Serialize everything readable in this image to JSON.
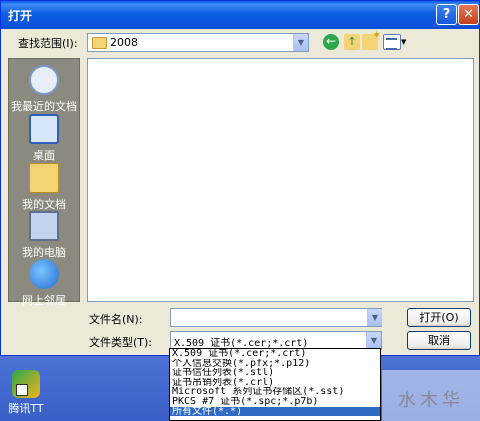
{
  "window": {
    "title": "打开",
    "help_label": "?",
    "close_label": "✕"
  },
  "toolbar": {
    "lookin_label": "查找范围(I):",
    "lookin_value": "2008",
    "back_icon": "back-arrow-icon",
    "up_icon": "up-folder-icon",
    "new_folder_icon": "new-folder-icon",
    "view_menu_icon": "view-menu-icon"
  },
  "places": [
    {
      "label": "我最近的文档",
      "icon": "recent-documents-icon"
    },
    {
      "label": "桌面",
      "icon": "desktop-icon"
    },
    {
      "label": "我的文档",
      "icon": "my-documents-icon"
    },
    {
      "label": "我的电脑",
      "icon": "my-computer-icon"
    },
    {
      "label": "网上邻居",
      "icon": "network-places-icon"
    }
  ],
  "form": {
    "filename_label": "文件名(N):",
    "filename_value": "",
    "filetype_label": "文件类型(T):",
    "filetype_value": "X.509 证书(*.cer;*.crt)",
    "open_button": "打开(O)",
    "cancel_button": "取消"
  },
  "filetype_options": [
    "X.509 证书(*.cer;*.crt)",
    "个人信息交换(*.pfx;*.p12)",
    "证书信任列表(*.stl)",
    "证书吊销列表(*.crl)",
    "Microsoft 系列证书存储区(*.sst)",
    "PKCS #7 证书(*.spc;*.p7b)",
    "所有文件(*.*)"
  ],
  "selected_option_index": 6,
  "desktop": {
    "icon_label": "腾讯TT",
    "watermark": "水木华"
  },
  "colors": {
    "titlebar": "#0a58ec",
    "selection": "#316ac5",
    "desktop": "#3a5fc8"
  }
}
